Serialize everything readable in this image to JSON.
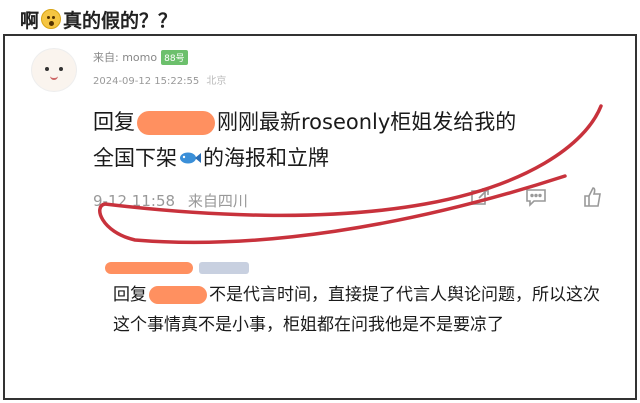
{
  "headline": {
    "prefix": "啊",
    "emoji": "astonished-face",
    "suffix": "真的假的？？"
  },
  "post": {
    "source_label": "来自: momo",
    "badge": "88号",
    "timestamp": "2024-09-12 15:22:55",
    "location": "北京"
  },
  "reply": {
    "prefix": "回复",
    "text_line1": "刚刚最新roseonly柜姐发给我的",
    "text_line2a": "全国下架",
    "text_line2b": "的海报和立牌",
    "time": "9-12 11:58",
    "from": "来自四川"
  },
  "actions": [
    "share-icon",
    "comment-icon",
    "like-icon"
  ],
  "sub_reply": {
    "prefix": "回复",
    "text": "不是代言时间，直接提了代言人舆论问题，所以这次这个事情真不是小事，柜姐都在问我他是不是要凉了"
  },
  "colors": {
    "scribble": "#c8323c",
    "redaction": "#ff9060"
  }
}
